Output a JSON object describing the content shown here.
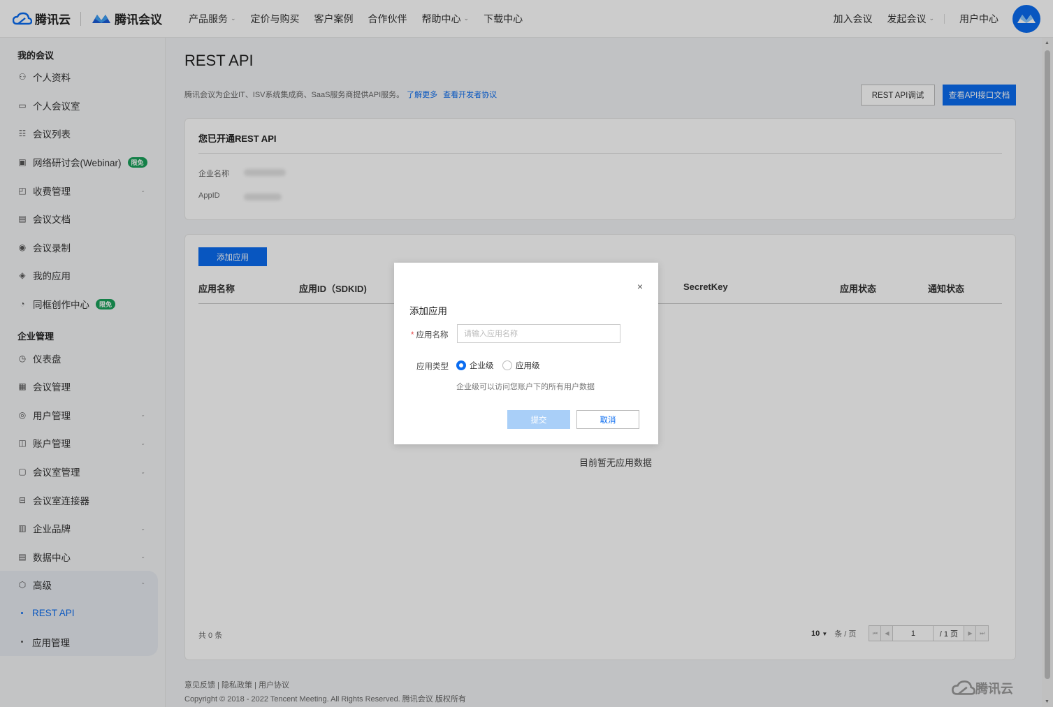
{
  "brand": {
    "tencent_cloud": "腾讯云",
    "tencent_meeting": "腾讯会议"
  },
  "nav": {
    "menu": [
      {
        "label": "产品服务",
        "dropdown": true
      },
      {
        "label": "定价与购买",
        "dropdown": false
      },
      {
        "label": "客户案例",
        "dropdown": false
      },
      {
        "label": "合作伙伴",
        "dropdown": false
      },
      {
        "label": "帮助中心",
        "dropdown": true
      },
      {
        "label": "下载中心",
        "dropdown": false
      }
    ],
    "join": "加入会议",
    "start": "发起会议",
    "user_center": "用户中心"
  },
  "sidebar": {
    "section1": "我的会议",
    "my_items": [
      {
        "label": "个人资料",
        "icon": "user-icon"
      },
      {
        "label": "个人会议室",
        "icon": "room-icon"
      },
      {
        "label": "会议列表",
        "icon": "list-icon"
      },
      {
        "label": "网络研讨会(Webinar)",
        "icon": "webinar-icon",
        "badge": "限免"
      },
      {
        "label": "收费管理",
        "icon": "bag-icon",
        "chev": true
      },
      {
        "label": "会议文档",
        "icon": "doc-icon"
      },
      {
        "label": "会议录制",
        "icon": "record-icon"
      },
      {
        "label": "我的应用",
        "icon": "layers-icon"
      },
      {
        "label": "同框创作中心",
        "icon": "create-icon",
        "badge": "限免"
      }
    ],
    "section2": "企业管理",
    "ent_items": [
      {
        "label": "仪表盘",
        "icon": "dashboard-icon"
      },
      {
        "label": "会议管理",
        "icon": "grid-icon"
      },
      {
        "label": "用户管理",
        "icon": "users-icon",
        "chev": true
      },
      {
        "label": "账户管理",
        "icon": "account-icon",
        "chev": true
      },
      {
        "label": "会议室管理",
        "icon": "meeting-room-icon",
        "chev": true
      },
      {
        "label": "会议室连接器",
        "icon": "connector-icon"
      },
      {
        "label": "企业品牌",
        "icon": "building-icon",
        "chev": true
      },
      {
        "label": "数据中心",
        "icon": "data-icon",
        "chev": true
      }
    ],
    "advanced": "高级",
    "advanced_subs": [
      {
        "label": "REST API",
        "active": true
      },
      {
        "label": "应用管理",
        "active": false
      }
    ]
  },
  "page": {
    "title": "REST API",
    "intro": "腾讯会议为企业IT、ISV系统集成商、SaaS服务商提供API服务。",
    "learn_more": "了解更多",
    "dev_agreement": "查看开发者协议",
    "btn_debug": "REST API调试",
    "btn_docs": "查看API接口文档"
  },
  "info_card": {
    "title": "您已开通REST API",
    "company_label": "企业名称",
    "appid_label": "AppID"
  },
  "apps_card": {
    "add_button": "添加应用",
    "columns": [
      "应用名称",
      "应用ID（SDKID)",
      "SecretKey",
      "应用状态",
      "通知状态"
    ],
    "empty": "目前暂无应用数据",
    "total": "共 0 条",
    "page_size": "10",
    "per_page": "条 / 页",
    "current_page": "1",
    "total_pages": "/ 1 页"
  },
  "footer": {
    "links": "意见反馈 | 隐私政策 | 用户协议",
    "copyright": "Copyright © 2018 - 2022 Tencent Meeting. All Rights Reserved. 腾讯会议 版权所有",
    "logo_text": "腾讯云"
  },
  "modal": {
    "title": "添加应用",
    "name_label": "应用名称",
    "name_placeholder": "请输入应用名称",
    "name_value": "",
    "type_label": "应用类型",
    "type_options": [
      "企业级",
      "应用级"
    ],
    "type_selected": "企业级",
    "hint": "企业级可以访问您账户下的所有用户数据",
    "submit": "提交",
    "cancel": "取消",
    "close": "×"
  },
  "colors": {
    "primary": "#0a6cf0",
    "badge": "#19a05a",
    "submit_disabled": "#a9cff8"
  }
}
